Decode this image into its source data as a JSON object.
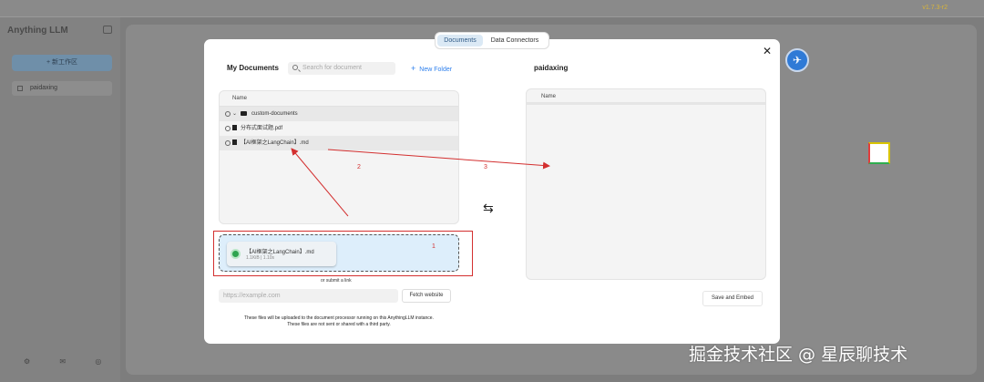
{
  "app": {
    "title": "Anything LLM",
    "version": "v1.7.3-r2",
    "new_workspace_label": "+ 新工作区",
    "workspace_name": "paidaxing",
    "footer_icons": [
      "tools-icon",
      "chat-icon",
      "discord-icon",
      "wrench-icon"
    ]
  },
  "modal": {
    "tabs": [
      {
        "label": "Documents",
        "active": true
      },
      {
        "label": "Data Connectors",
        "active": false
      }
    ],
    "left_title": "My Documents",
    "search_placeholder": "Search for document",
    "new_folder_label": "New Folder",
    "right_title": "paidaxing",
    "list_header": "Name",
    "folder_name": "custom-documents",
    "files": [
      "分布式面试题.pdf",
      "【AI框架之LangChain】.md"
    ],
    "right_header": "Name",
    "upload": {
      "file_name": "【AI框架之LangChain】.md",
      "file_meta": "1.1KiB | 1.10s"
    },
    "or_link": "or submit a link",
    "url_placeholder": "https://example.com",
    "fetch_label": "Fetch website",
    "note_line1": "These files will be uploaded to the document processor running on this AnythingLLM instance.",
    "note_line2": "These files are not sent or shared with a third party.",
    "embed_label": "Save and Embed"
  },
  "annotations": {
    "n1": "1",
    "n2": "2",
    "n3": "3",
    "color": "#d32f2f"
  },
  "watermark": "掘金技术社区 @ 星辰聊技术"
}
